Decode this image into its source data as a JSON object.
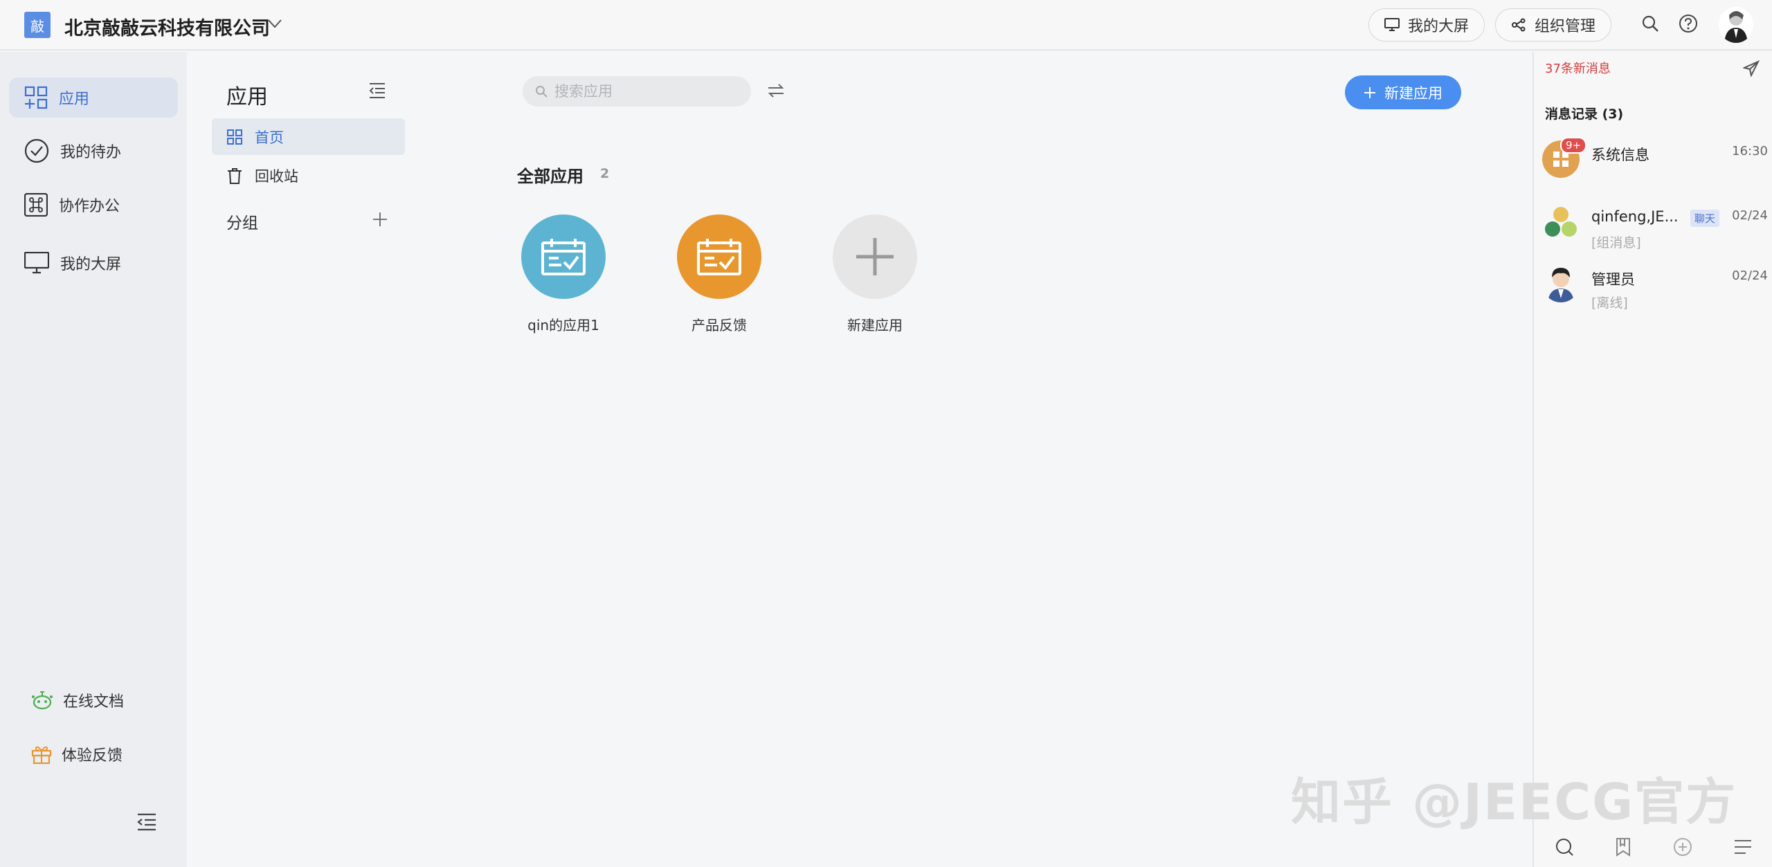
{
  "header": {
    "logo_char": "敲",
    "company": "北京敲敲云科技有限公司",
    "my_screen_label": "我的大屏",
    "org_manage_label": "组织管理"
  },
  "leftnav": {
    "items": [
      {
        "label": "应用"
      },
      {
        "label": "我的待办"
      },
      {
        "label": "协作办公"
      },
      {
        "label": "我的大屏"
      }
    ],
    "bottom": [
      {
        "label": "在线文档"
      },
      {
        "label": "体验反馈"
      }
    ]
  },
  "subnav": {
    "title": "应用",
    "items": [
      {
        "label": "首页"
      },
      {
        "label": "回收站"
      }
    ],
    "group_label": "分组"
  },
  "main": {
    "search_placeholder": "搜索应用",
    "new_app_label": "新建应用",
    "all_apps_title": "全部应用",
    "all_apps_count": "2",
    "apps": [
      {
        "name": "qin的应用1",
        "color": "#5cb4d2"
      },
      {
        "name": "产品反馈",
        "color": "#e8972e"
      },
      {
        "name": "新建应用",
        "color": "#e6e6e6"
      }
    ]
  },
  "rightpanel": {
    "new_msg": "37条新消息",
    "msg_record": "消息记录 (3)",
    "messages": [
      {
        "name": "系统信息",
        "sub": "",
        "time": "16:30",
        "badge": "9+"
      },
      {
        "name": "qinfeng,JE...",
        "sub": "[组消息]",
        "time": "02/24",
        "tag": "聊天"
      },
      {
        "name": "管理员",
        "sub": "[离线]",
        "time": "02/24"
      }
    ]
  },
  "watermark": "知乎 @JEECG官方",
  "colors": {
    "accent": "#4a8ff0",
    "active_text": "#3b6fd1",
    "alert": "#d13f3f"
  }
}
